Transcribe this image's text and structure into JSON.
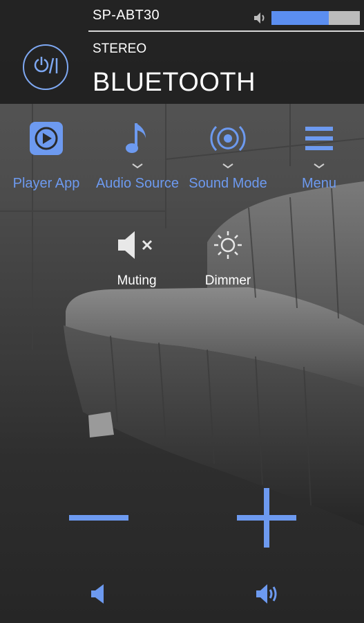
{
  "header": {
    "device_name": "SP-ABT30",
    "audio_mode": "STEREO",
    "source": "BLUETOOTH",
    "volume_level_fraction": 0.65,
    "power_icon": "power-icon"
  },
  "menu": {
    "items": [
      {
        "label": "Player App",
        "icon": "play-icon"
      },
      {
        "label": "Audio Source",
        "icon": "music-note-icon"
      },
      {
        "label": "Sound Mode",
        "icon": "surround-icon"
      },
      {
        "label": "Menu",
        "icon": "hamburger-icon"
      }
    ]
  },
  "controls": {
    "muting_label": "Muting",
    "dimmer_label": "Dimmer"
  },
  "volume_controls": {
    "minus_icon": "minus-icon",
    "plus_icon": "plus-icon",
    "volume_down_icon": "speaker-low-icon",
    "volume_up_icon": "speaker-high-icon"
  },
  "colors": {
    "accent": "#6d9af0",
    "header_bg": "#1e1e1e",
    "volume_fill": "#5b8ef0"
  }
}
